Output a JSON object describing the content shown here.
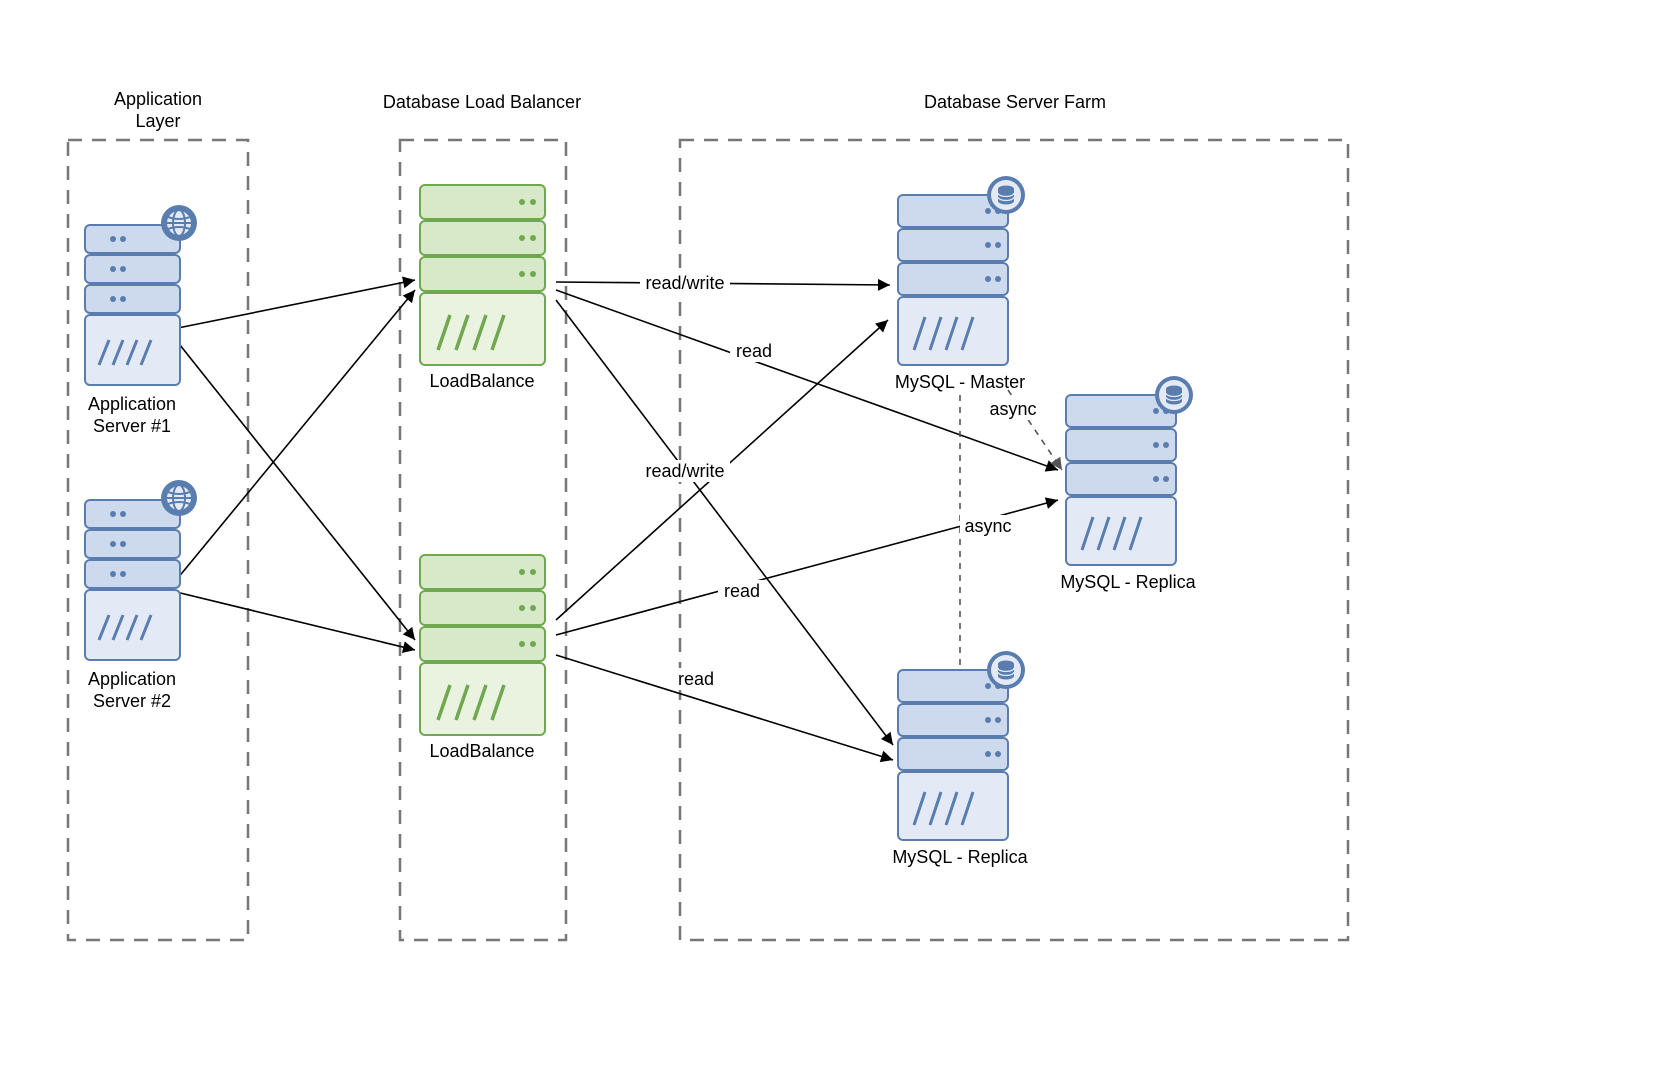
{
  "groups": {
    "app": {
      "title_line1": "Application",
      "title_line2": "Layer"
    },
    "lb": {
      "title": "Database Load Balancer"
    },
    "farm": {
      "title": "Database Server Farm"
    }
  },
  "nodes": {
    "app1": {
      "label_line1": "Application",
      "label_line2": "Server #1"
    },
    "app2": {
      "label_line1": "Application",
      "label_line2": "Server #2"
    },
    "lb1": {
      "label": "LoadBalance"
    },
    "lb2": {
      "label": "LoadBalance"
    },
    "master": {
      "label": "MySQL - Master"
    },
    "replica1": {
      "label": "MySQL - Replica"
    },
    "replica2": {
      "label": "MySQL - Replica"
    }
  },
  "edge_labels": {
    "rw1": "read/write",
    "rw2": "read/write",
    "read1": "read",
    "read2": "read",
    "read3": "read",
    "async1": "async",
    "async2": "async"
  },
  "colors": {
    "blue_stroke": "#5a7db0",
    "blue_fill": "#cdd9ec",
    "blue_light": "#e3eaf5",
    "green_stroke": "#6fa84f",
    "green_fill": "#d7e9c8",
    "green_light": "#eaf3e0"
  }
}
